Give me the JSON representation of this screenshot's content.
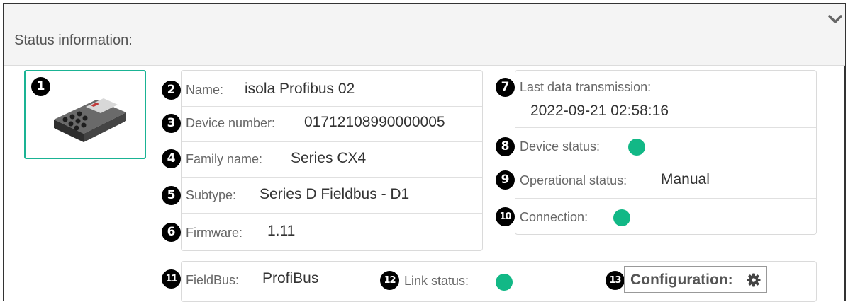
{
  "header": {
    "title": "Status information:"
  },
  "device_image": {
    "badge": "1",
    "alt": "device-image"
  },
  "left_panel": {
    "rows": [
      {
        "badge": "2",
        "label": "Name:",
        "value": "isola Profibus 02"
      },
      {
        "badge": "3",
        "label": "Device number:",
        "value": "01712108990000005"
      },
      {
        "badge": "4",
        "label": "Family name:",
        "value": "Series CX4"
      },
      {
        "badge": "5",
        "label": "Subtype:",
        "value": "Series D Fieldbus - D1"
      },
      {
        "badge": "6",
        "label": "Firmware:",
        "value": "1.11"
      }
    ]
  },
  "right_panel": {
    "last_transmission": {
      "badge": "7",
      "label": "Last data transmission:",
      "value": "2022-09-21 02:58:16"
    },
    "device_status": {
      "badge": "8",
      "label": "Device status:",
      "status_color": "#12b886"
    },
    "operational_status": {
      "badge": "9",
      "label": "Operational status:",
      "value": "Manual"
    },
    "connection": {
      "badge": "10",
      "label": "Connection:",
      "status_color": "#12b886"
    }
  },
  "bottom_panel": {
    "fieldbus": {
      "badge": "11",
      "label": "FieldBus:",
      "value": "ProfiBus"
    },
    "link_status": {
      "badge": "12",
      "label": "Link status:",
      "status_color": "#12b886"
    },
    "configuration": {
      "badge": "13",
      "label": "Configuration:",
      "icon": "gear-icon"
    }
  },
  "colors": {
    "accent": "#1ab394",
    "status_ok": "#12b886"
  }
}
